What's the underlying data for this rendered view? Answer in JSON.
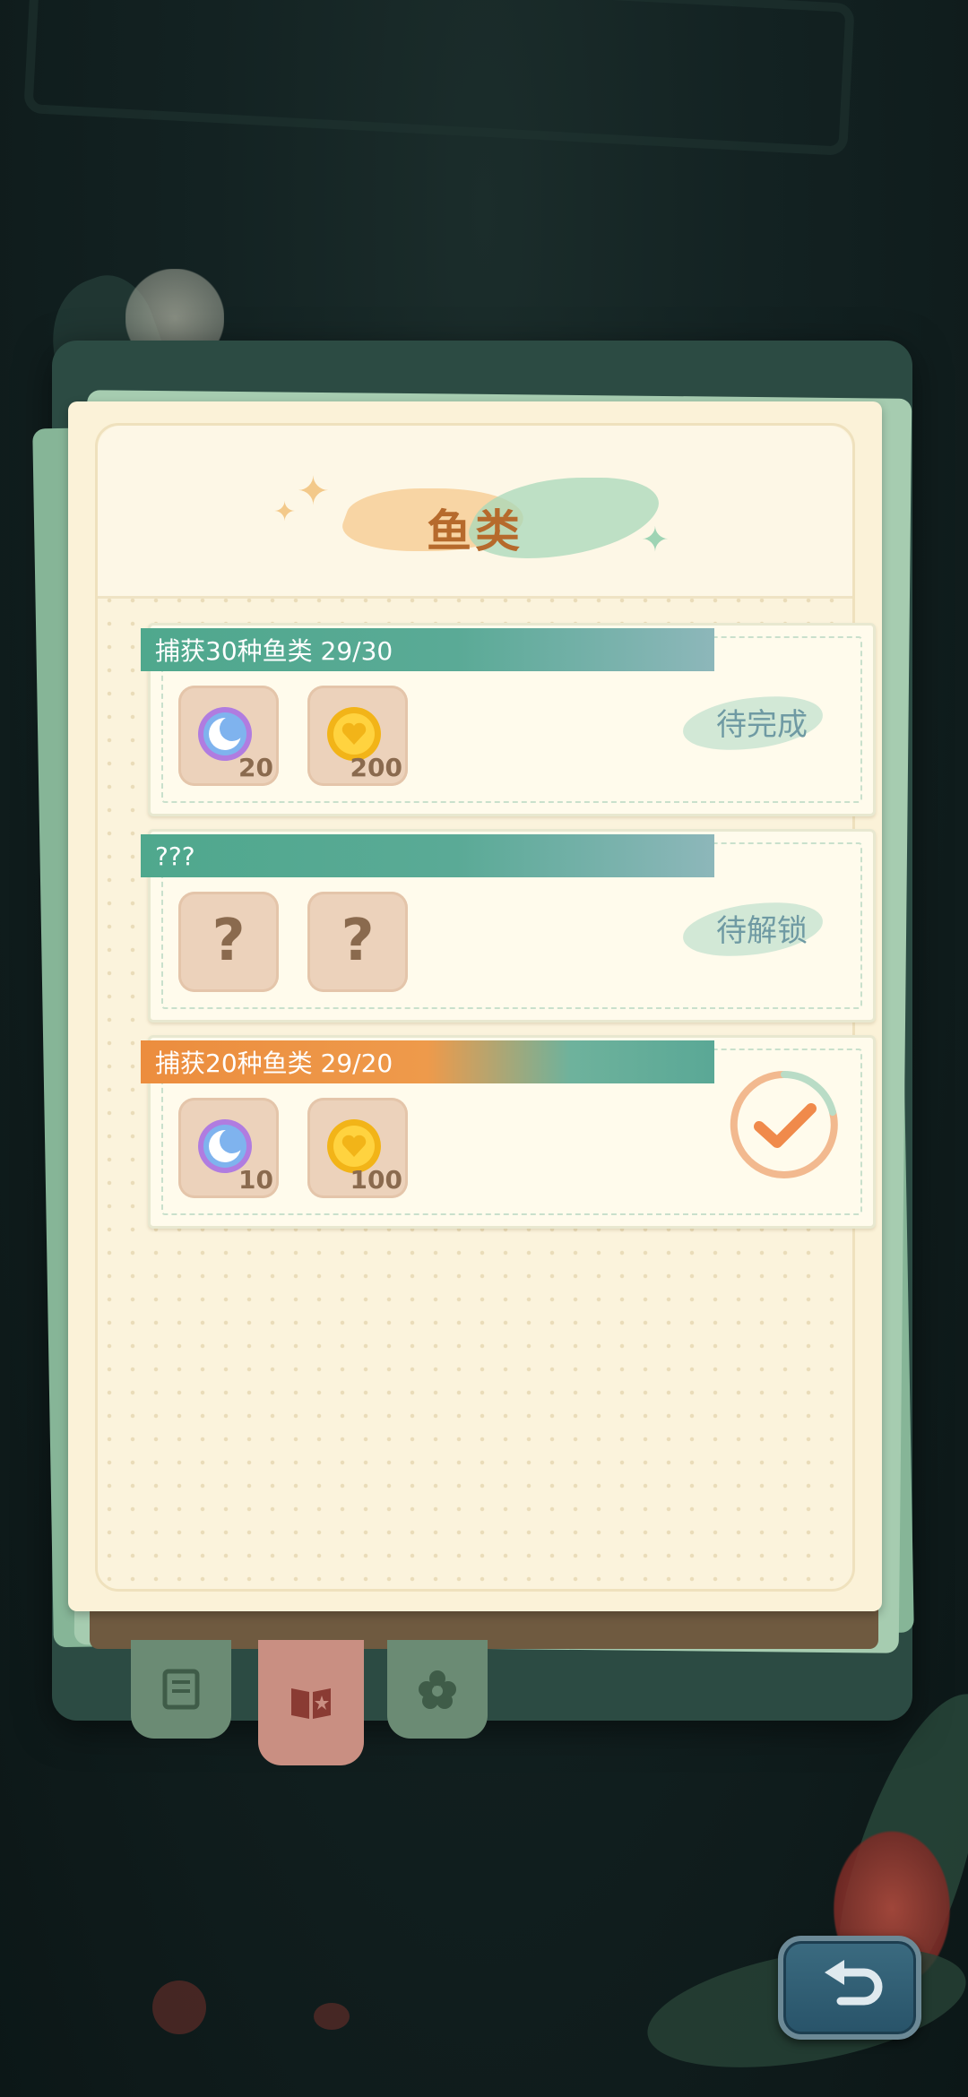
{
  "page": {
    "title": "鱼类"
  },
  "tasks": [
    {
      "label": "捕获30种鱼类 29/30",
      "ribbon_color": "#4fa88d",
      "rewards": [
        {
          "icon": "moon-orb-icon",
          "count": "20"
        },
        {
          "icon": "gold-heart-coin-icon",
          "count": "200"
        }
      ],
      "status": "待完成"
    },
    {
      "label": "???",
      "ribbon_color": "#4fa88d",
      "rewards": [
        {
          "icon": "question-mark-icon",
          "count": ""
        },
        {
          "icon": "question-mark-icon",
          "count": ""
        }
      ],
      "status": "待解锁"
    },
    {
      "label": "捕获20种鱼类 29/20",
      "ribbon_color": "#ec8d3e",
      "rewards": [
        {
          "icon": "moon-orb-icon",
          "count": "10"
        },
        {
          "icon": "gold-heart-coin-icon",
          "count": "100"
        }
      ],
      "status_icon": "checkmark-icon"
    }
  ],
  "tabs": [
    {
      "icon": "scroll-icon",
      "active": false
    },
    {
      "icon": "book-icon",
      "active": true
    },
    {
      "icon": "flower-icon",
      "active": false
    }
  ],
  "back_button": {
    "icon": "return-arrow-icon"
  },
  "colors": {
    "accent_green": "#4fa88d",
    "accent_orange": "#ec8d3e",
    "paper": "#fbf2d8",
    "title": "#b66a2c"
  }
}
